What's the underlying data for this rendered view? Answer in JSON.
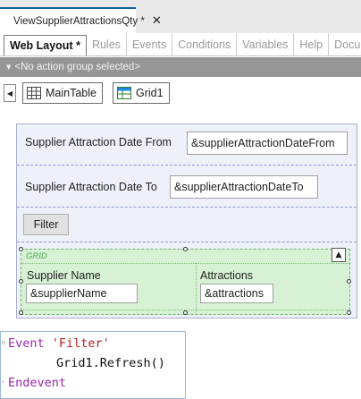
{
  "window": {
    "tab_title": "ViewSupplierAttractionsQty *",
    "tab_close": "✕"
  },
  "subtabs": [
    "Web Layout *",
    "Rules",
    "Events",
    "Conditions",
    "Variables",
    "Help",
    "Docum"
  ],
  "action_group": "<No action group selected>",
  "breadcrumbs": {
    "main": "MainTable",
    "grid": "Grid1"
  },
  "form": {
    "date_from_label": "Supplier Attraction Date From",
    "date_from_value": "&supplierAttractionDateFrom",
    "date_to_label": "Supplier Attraction Date To",
    "date_to_value": "&supplierAttractionDateTo",
    "filter_button": "Filter"
  },
  "grid": {
    "caption": "GRID",
    "columns": [
      {
        "header": "Supplier Name",
        "value": "&supplierName"
      },
      {
        "header": "Attractions",
        "value": "&attractions"
      }
    ]
  },
  "code": {
    "line1_kw": "Event",
    "line1_str": "'Filter'",
    "line2": "Grid1.Refresh()",
    "line3_kw": "Endevent"
  },
  "colors": {
    "accent": "#0e639c",
    "canvas_bg": "#eef0fa",
    "grid_bg": "#d7f1d4",
    "keyword": "#9c27b0",
    "string": "#b22222"
  }
}
